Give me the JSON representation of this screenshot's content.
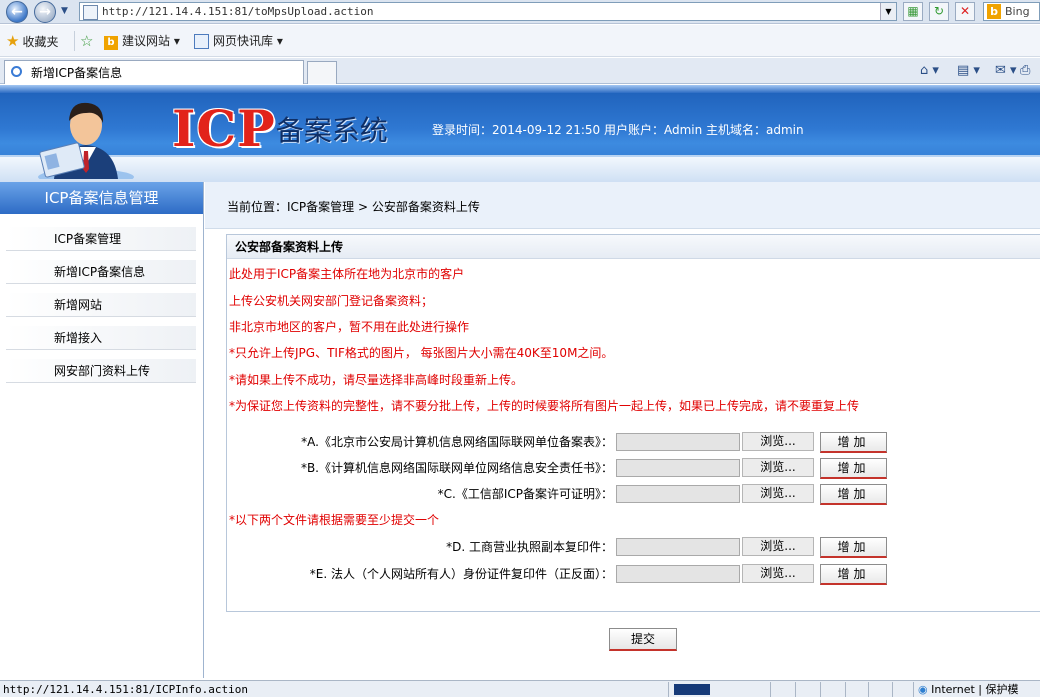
{
  "browser": {
    "url": "http://121.14.4.151:81/toMpsUpload.action",
    "search_engine": "Bing",
    "favorites_label": "收藏夹",
    "fav_items": [
      "建议网站",
      "网页快讯库"
    ],
    "tab_title": "新增ICP备案信息",
    "status_url": "http://121.14.4.151:81/ICPInfo.action",
    "zone_label": "Internet",
    "protected_mode": "保护模"
  },
  "header": {
    "logo_big": "ICP",
    "logo_small": "备案系统",
    "login_info": "登录时间：2014-09-12 21:50  用户账户：Admin  主机域名：admin"
  },
  "sidebar": {
    "title": "ICP备案信息管理",
    "items": [
      "ICP备案管理",
      "新增ICP备案信息",
      "新增网站",
      "新增接入",
      "网安部门资料上传"
    ]
  },
  "breadcrumb": "当前位置：ICP备案管理 > 公安部备案资料上传",
  "panel": {
    "title": "公安部备案资料上传",
    "notes": [
      "此处用于ICP备案主体所在地为北京市的客户",
      "上传公安机关网安部门登记备案资料；",
      "非北京市地区的客户，暂不用在此处进行操作",
      "*只允许上传JPG、TIF格式的图片，  每张图片大小需在40K至10M之间。",
      "*请如果上传不成功，请尽量选择非高峰时段重新上传。",
      "*为保证您上传资料的完整性，请不要分批上传，上传的时候要将所有图片一起上传，如果已上传完成，请不要重复上传"
    ],
    "rows_group1": [
      "*A.《北京市公安局计算机信息网络国际联网单位备案表》：",
      "*B.《计算机信息网络国际联网单位网络信息安全责任书》：",
      "*C.《工信部ICP备案许可证明》："
    ],
    "group2_note": "*以下两个文件请根据需要至少提交一个",
    "rows_group2": [
      "*D. 工商营业执照副本复印件：",
      "*E. 法人（个人网站所有人）身份证件复印件（正反面）："
    ],
    "browse_label": "浏览...",
    "add_label": "增加"
  },
  "submit_label": "提交"
}
